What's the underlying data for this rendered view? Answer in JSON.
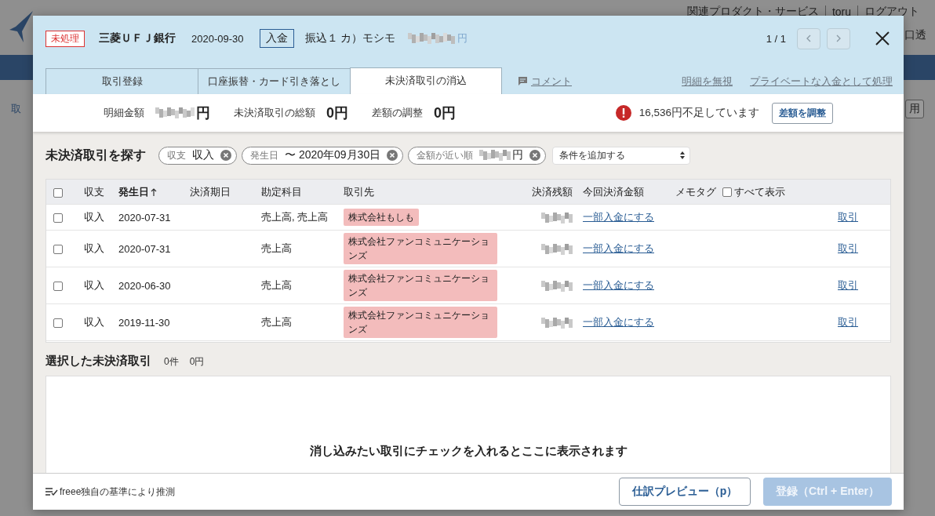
{
  "background_page": {
    "header_links": [
      "関連プロダクト・サービス",
      "toru",
      "ログアウト"
    ],
    "fragments": [
      "口透",
      "取",
      "用"
    ]
  },
  "modal": {
    "header": {
      "status": "未処理",
      "bank": "三菱ＵＦＪ銀行",
      "date": "2020-09-30",
      "direction": "入金",
      "description": "振込１ カ）モシモ",
      "amount_unit": "円",
      "pager": "1 / 1",
      "prev_disabled": true,
      "next_disabled": true
    },
    "tabs": [
      {
        "label": "取引登録",
        "selected": false
      },
      {
        "label": "口座振替・カード引き落とし",
        "selected": false
      },
      {
        "label": "未決済取引の消込",
        "selected": true
      }
    ],
    "links": [
      {
        "label": "コメント",
        "kind": "comment"
      },
      {
        "label": "明細を無視",
        "kind": "plain"
      },
      {
        "label": "プライベートな入金として処理",
        "kind": "plain"
      }
    ],
    "summary": {
      "items": [
        {
          "label": "明細金額",
          "kind": "redacted",
          "unit": "円"
        },
        {
          "label": "未決済取引の総額",
          "kind": "value",
          "value": "0円"
        },
        {
          "label": "差額の調整",
          "kind": "value",
          "value": "0円"
        }
      ],
      "alert": "16,536円不足しています",
      "adjust_button": "差額を調整"
    },
    "search": {
      "title": "未決済取引を探す",
      "filters": [
        {
          "label": "収支",
          "kind": "text",
          "value": "収入"
        },
        {
          "label": "発生日",
          "kind": "text",
          "value": "〜 2020年09月30日"
        },
        {
          "label": "金額が近い順",
          "kind": "redacted",
          "unit": "円"
        }
      ],
      "add_condition": "条件を追加する"
    },
    "table": {
      "select_all_checked": false,
      "columns": [
        {
          "label": "収支",
          "sorted": false
        },
        {
          "label": "発生日",
          "sorted": true
        },
        {
          "label": "決済期日",
          "sorted": false
        },
        {
          "label": "勘定科目",
          "sorted": false
        },
        {
          "label": "取引先",
          "sorted": false
        },
        {
          "label": "決済残額",
          "sorted": false
        },
        {
          "label": "今回決済金額",
          "sorted": false
        },
        {
          "label": "メモタグ",
          "sorted": false
        }
      ],
      "show_all": {
        "label": "すべて表示",
        "checked": false
      },
      "rows": [
        {
          "checked": false,
          "type": "収入",
          "date": "2020-07-31",
          "account": "売上高, 売上高",
          "partner": "株式会社もしも",
          "partial_link": "一部入金にする",
          "action": "取引"
        },
        {
          "checked": false,
          "type": "収入",
          "date": "2020-07-31",
          "account": "売上高",
          "partner": "株式会社ファンコミュニケーションズ",
          "partial_link": "一部入金にする",
          "action": "取引"
        },
        {
          "checked": false,
          "type": "収入",
          "date": "2020-06-30",
          "account": "売上高",
          "partner": "株式会社ファンコミュニケーションズ",
          "partial_link": "一部入金にする",
          "action": "取引"
        },
        {
          "checked": false,
          "type": "収入",
          "date": "2019-11-30",
          "account": "売上高",
          "partner": "株式会社ファンコミュニケーションズ",
          "partial_link": "一部入金にする",
          "action": "取引"
        }
      ]
    },
    "selected": {
      "title": "選択した未決済取引",
      "count": "0件",
      "amount": "0円",
      "empty_message": "消し込みたい取引にチェックを入れるとここに表示されます"
    },
    "footer": {
      "note": "freee独自の基準により推測",
      "preview_button": "仕訳プレビュー（p）",
      "register_button": "登録（Ctrl + Enter）",
      "register_disabled": true
    }
  }
}
